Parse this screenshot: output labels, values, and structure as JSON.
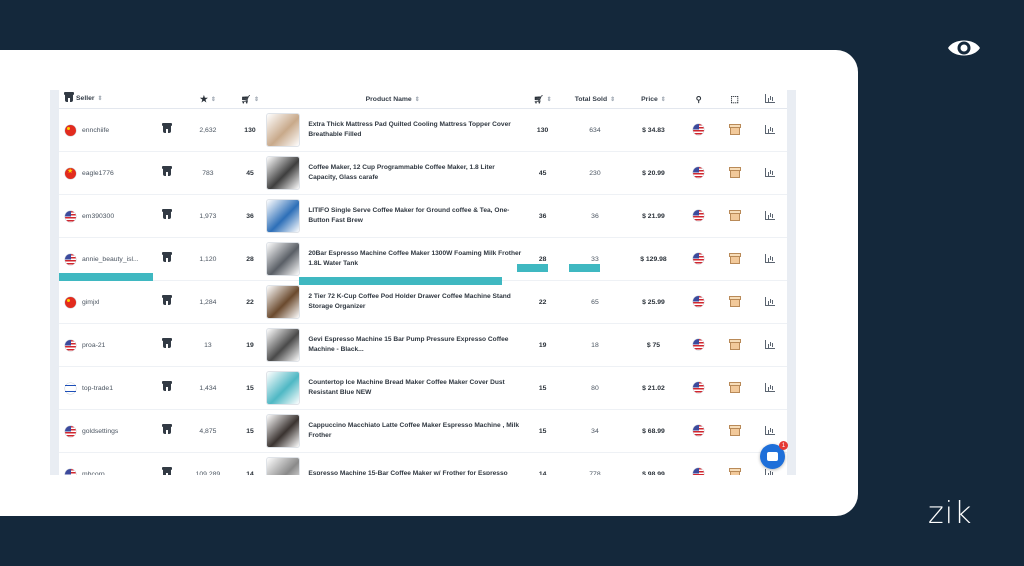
{
  "brand": {
    "logo_text": "zik"
  },
  "table": {
    "headers": {
      "seller": "Seller",
      "rating": "",
      "sales": "",
      "product_name": "Product Name",
      "cart": "",
      "total_sold": "Total Sold",
      "price": "Price"
    },
    "rows": [
      {
        "flag": "cn",
        "seller": "ennchiife",
        "feedback": "2,632",
        "sales": "130",
        "thumb_color": "#c8a98a",
        "name": "Extra Thick Mattress Pad Quilted Cooling Mattress Topper Cover Breathable Filled",
        "sold_7d": "130",
        "total_sold": "634",
        "price": "$ 34.83"
      },
      {
        "flag": "vn",
        "seller": "eagle1776",
        "feedback": "783",
        "sales": "45",
        "thumb_color": "#3e3e3e",
        "name": "Coffee Maker, 12 Cup Programmable Coffee Maker, 1.8 Liter Capacity, Glass carafe",
        "sold_7d": "45",
        "total_sold": "230",
        "price": "$ 20.99"
      },
      {
        "flag": "us",
        "seller": "em390300",
        "feedback": "1,973",
        "sales": "36",
        "thumb_color": "#2d6fb8",
        "name": "LITIFO Single Serve Coffee Maker for Ground coffee & Tea, One-Button Fast Brew",
        "sold_7d": "36",
        "total_sold": "36",
        "price": "$ 21.99"
      },
      {
        "flag": "us",
        "seller": "annie_beauty_isl...",
        "feedback": "1,120",
        "sales": "28",
        "thumb_color": "#5a5f66",
        "name": "20Bar Espresso Machine Coffee Maker 1300W Foaming Milk Frother 1.8L Water Tank",
        "sold_7d": "28",
        "total_sold": "33",
        "price": "$ 129.98"
      },
      {
        "flag": "cn",
        "seller": "gimjxl",
        "feedback": "1,284",
        "sales": "22",
        "thumb_color": "#6b4a2e",
        "name": "2 Tier 72 K-Cup Coffee Pod Holder Drawer Coffee Machine Stand Storage Organizer",
        "sold_7d": "22",
        "total_sold": "65",
        "price": "$ 25.99"
      },
      {
        "flag": "us",
        "seller": "proa-21",
        "feedback": "13",
        "sales": "19",
        "thumb_color": "#4a4a4a",
        "name": "Gevi Espresso Machine 15 Bar Pump Pressure Expresso Coffee Machine - Black...",
        "sold_7d": "19",
        "total_sold": "18",
        "price": "$ 75"
      },
      {
        "flag": "il",
        "seller": "top-trade1",
        "feedback": "1,434",
        "sales": "15",
        "thumb_color": "#4fb8c4",
        "name": "Countertop Ice Machine Bread Maker Coffee Maker Cover Dust Resistant Blue NEW",
        "sold_7d": "15",
        "total_sold": "80",
        "price": "$ 21.02"
      },
      {
        "flag": "us",
        "seller": "goldsettings",
        "feedback": "4,875",
        "sales": "15",
        "thumb_color": "#3a3330",
        "name": "Cappuccino Macchiato Latte Coffee Maker Espresso Machine , Milk Frother",
        "sold_7d": "15",
        "total_sold": "34",
        "price": "$ 68.99"
      },
      {
        "flag": "us",
        "seller": "mbcorp",
        "feedback": "109,289",
        "sales": "14",
        "thumb_color": "#8a8a8a",
        "name": "Espresso Machine 15-Bar Coffee Maker w/ Frother for Espresso",
        "sold_7d": "14",
        "total_sold": "778",
        "price": "$ 98.99"
      }
    ]
  },
  "chat": {
    "badge_count": "1"
  },
  "colors": {
    "background": "#14283b",
    "highlight": "#3fb8c1",
    "chat": "#1e6fd9"
  }
}
